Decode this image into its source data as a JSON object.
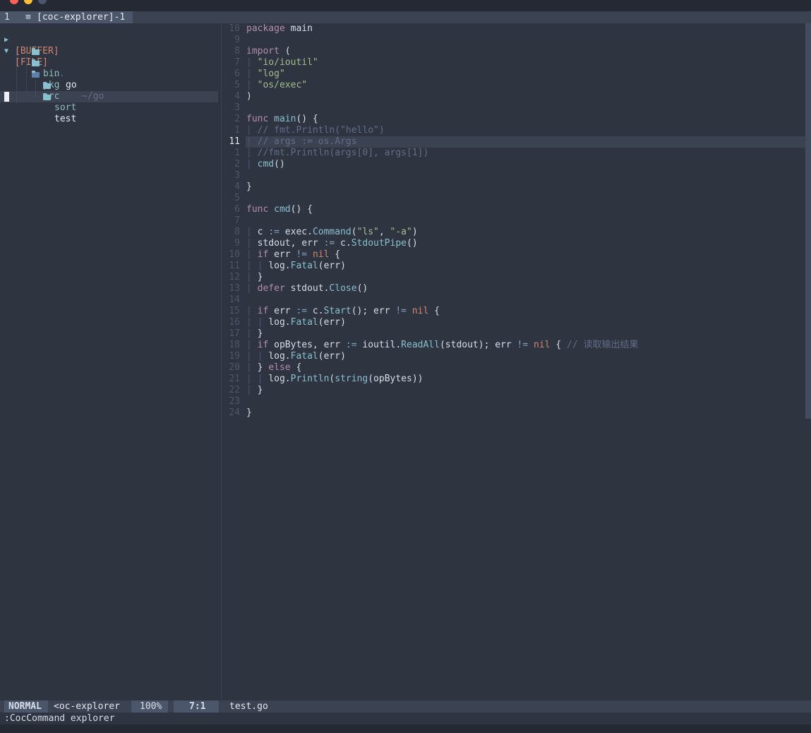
{
  "tabline": {
    "tab_number": "1",
    "tab_icon": "list-icon",
    "tab_label": "[coc-explorer]-1"
  },
  "explorer": {
    "buffer_root": "[BUFFER]",
    "file_root": "[FILE]",
    "file_root_dots": "..",
    "file_root_name": "go",
    "file_root_path": "~/go",
    "items": [
      {
        "name": "bin",
        "depth": 1
      },
      {
        "name": "pkg",
        "depth": 1
      },
      {
        "name": "src",
        "depth": 1,
        "open": true
      },
      {
        "name": "sort",
        "depth": 2
      },
      {
        "name": "test",
        "depth": 2,
        "selected": true
      }
    ]
  },
  "editor": {
    "filename": "test.go",
    "current_line_number": "11",
    "line_numbers": [
      "10",
      "9",
      "8",
      "7",
      "6",
      "5",
      "4",
      "3",
      "2",
      "1",
      "11",
      "1",
      "2",
      "3",
      "4",
      "5",
      "6",
      "7",
      "8",
      "9",
      "10",
      "11",
      "12",
      "13",
      "14",
      "15",
      "16",
      "17",
      "18",
      "19",
      "20",
      "21",
      "22",
      "23",
      "24"
    ],
    "lines": [
      [
        [
          "kw",
          "package"
        ],
        [
          "id",
          " main"
        ]
      ],
      [],
      [
        [
          "kw",
          "import"
        ],
        [
          "id",
          " ("
        ]
      ],
      [
        [
          "ig",
          "| "
        ],
        [
          "str",
          "\"io/ioutil\""
        ]
      ],
      [
        [
          "ig",
          "| "
        ],
        [
          "str",
          "\"log\""
        ]
      ],
      [
        [
          "ig",
          "| "
        ],
        [
          "str",
          "\"os/exec\""
        ]
      ],
      [
        [
          "id",
          ")"
        ]
      ],
      [],
      [
        [
          "kw",
          "func"
        ],
        [
          "id",
          " "
        ],
        [
          "fn",
          "main"
        ],
        [
          "id",
          "() {"
        ]
      ],
      [
        [
          "ig",
          "| "
        ],
        [
          "cm",
          "// fmt.Println(\"hello\")"
        ]
      ],
      [
        [
          "ig",
          "| "
        ],
        [
          "cm",
          "// args := os.Args"
        ]
      ],
      [
        [
          "ig",
          "| "
        ],
        [
          "cm",
          "//fmt.Println(args[0], args[1])"
        ]
      ],
      [
        [
          "ig",
          "| "
        ],
        [
          "fn",
          "cmd"
        ],
        [
          "id",
          "()"
        ]
      ],
      [],
      [
        [
          "id",
          "}"
        ]
      ],
      [],
      [
        [
          "kw",
          "func"
        ],
        [
          "id",
          " "
        ],
        [
          "fn",
          "cmd"
        ],
        [
          "id",
          "() {"
        ]
      ],
      [],
      [
        [
          "ig",
          "| "
        ],
        [
          "id",
          "c "
        ],
        [
          "op",
          ":="
        ],
        [
          "id",
          " exec."
        ],
        [
          "fn",
          "Command"
        ],
        [
          "id",
          "("
        ],
        [
          "str",
          "\"ls\""
        ],
        [
          "id",
          ", "
        ],
        [
          "str",
          "\"-a\""
        ],
        [
          "id",
          ")"
        ]
      ],
      [
        [
          "ig",
          "| "
        ],
        [
          "id",
          "stdout, err "
        ],
        [
          "op",
          ":="
        ],
        [
          "id",
          " c."
        ],
        [
          "fn",
          "StdoutPipe"
        ],
        [
          "id",
          "()"
        ]
      ],
      [
        [
          "ig",
          "| "
        ],
        [
          "kw",
          "if"
        ],
        [
          "id",
          " err "
        ],
        [
          "op",
          "!="
        ],
        [
          "id",
          " "
        ],
        [
          "nil",
          "nil"
        ],
        [
          "id",
          " {"
        ]
      ],
      [
        [
          "ig",
          "| | "
        ],
        [
          "id",
          "log."
        ],
        [
          "fn",
          "Fatal"
        ],
        [
          "id",
          "(err)"
        ]
      ],
      [
        [
          "ig",
          "| "
        ],
        [
          "id",
          "}"
        ]
      ],
      [
        [
          "ig",
          "| "
        ],
        [
          "kw",
          "defer"
        ],
        [
          "id",
          " stdout."
        ],
        [
          "fn",
          "Close"
        ],
        [
          "id",
          "()"
        ]
      ],
      [],
      [
        [
          "ig",
          "| "
        ],
        [
          "kw",
          "if"
        ],
        [
          "id",
          " err "
        ],
        [
          "op",
          ":="
        ],
        [
          "id",
          " c."
        ],
        [
          "fn",
          "Start"
        ],
        [
          "id",
          "(); err "
        ],
        [
          "op",
          "!="
        ],
        [
          "id",
          " "
        ],
        [
          "nil",
          "nil"
        ],
        [
          "id",
          " {"
        ]
      ],
      [
        [
          "ig",
          "| | "
        ],
        [
          "id",
          "log."
        ],
        [
          "fn",
          "Fatal"
        ],
        [
          "id",
          "(err)"
        ]
      ],
      [
        [
          "ig",
          "| "
        ],
        [
          "id",
          "}"
        ]
      ],
      [
        [
          "ig",
          "| "
        ],
        [
          "kw",
          "if"
        ],
        [
          "id",
          " opBytes, err "
        ],
        [
          "op",
          ":="
        ],
        [
          "id",
          " ioutil."
        ],
        [
          "fn",
          "ReadAll"
        ],
        [
          "id",
          "(stdout); err "
        ],
        [
          "op",
          "!="
        ],
        [
          "id",
          " "
        ],
        [
          "nil",
          "nil"
        ],
        [
          "id",
          " { "
        ],
        [
          "cm",
          "// 读取输出结果"
        ]
      ],
      [
        [
          "ig",
          "| | "
        ],
        [
          "id",
          "log."
        ],
        [
          "fn",
          "Fatal"
        ],
        [
          "id",
          "(err)"
        ]
      ],
      [
        [
          "ig",
          "| "
        ],
        [
          "id",
          "} "
        ],
        [
          "kw",
          "else"
        ],
        [
          "id",
          " {"
        ]
      ],
      [
        [
          "ig",
          "| | "
        ],
        [
          "id",
          "log."
        ],
        [
          "fn",
          "Println"
        ],
        [
          "id",
          "("
        ],
        [
          "fn",
          "string"
        ],
        [
          "id",
          "(opBytes))"
        ]
      ],
      [
        [
          "ig",
          "| "
        ],
        [
          "id",
          "}"
        ]
      ],
      [],
      [
        [
          "id",
          "}"
        ]
      ]
    ]
  },
  "statusline": {
    "mode": "NORMAL",
    "buffer": "<oc-explorer",
    "percent": "100%",
    "position": "7:1",
    "file": "test.go"
  },
  "cmdline": ":CocCommand explorer",
  "colors": {
    "background": "#2e3440",
    "accent": "#88c0d0",
    "keyword": "#b48ead",
    "string": "#a3be8c",
    "root_label": "#d08770"
  }
}
